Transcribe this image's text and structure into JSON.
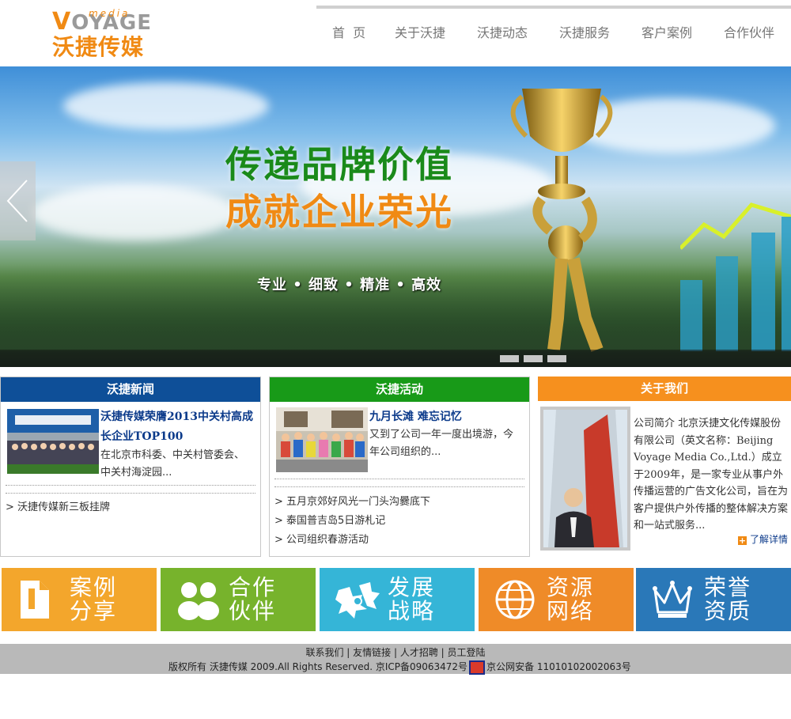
{
  "header": {
    "logo_en_v": "V",
    "logo_en_rest": "OYAGE",
    "logo_media": "media",
    "logo_cn": "沃捷传媒",
    "nav": [
      "首  页",
      "关于沃捷",
      "沃捷动态",
      "沃捷服务",
      "客户案例",
      "合作伙伴"
    ]
  },
  "banner": {
    "title1": "传递品牌价值",
    "title2": "成就企业荣光",
    "slogan": "专业 • 细致 • 精准 • 高效",
    "slide_count": 3
  },
  "news": {
    "heading": "沃捷新闻",
    "featured_title": "沃捷传媒荣膺2013中关村高成长企业TOP100",
    "featured_title_line1": "沃捷传媒荣膺2013中关村高成",
    "featured_title_line2": "长企业TOP100",
    "featured_text_line1": "在北京市科委、中关村管委会、",
    "featured_text_line2": "中关村海淀园...",
    "list": [
      "> 沃捷传媒新三板挂牌"
    ]
  },
  "activity": {
    "heading": "沃捷活动",
    "featured_title": "九月长滩  难忘记忆",
    "featured_text_line1": "又到了公司一年一度出境游，今",
    "featured_text_line2": "年公司组织的...",
    "list": [
      "> 五月京郊好风光一门头沟爨底下",
      "> 泰国普吉岛5日游札记",
      "> 公司组织春游活动"
    ]
  },
  "about": {
    "heading": "关于我们",
    "text": "公司简介 北京沃捷文化传媒股份有限公司（英文名称：Beijing Voyage Media Co.,Ltd.）成立于2009年，是一家专业从事户外传播运营的广告文化公司，旨在为客户提供户外传播的整体解决方案和一站式服务...",
    "more": "了解详情"
  },
  "tiles": [
    {
      "line1": "案例",
      "line2": "分享",
      "icon": "document-icon",
      "color": "#f3a62c"
    },
    {
      "line1": "合作",
      "line2": "伙伴",
      "icon": "partners-icon",
      "color": "#77b32c"
    },
    {
      "line1": "发展",
      "line2": "战略",
      "icon": "holly-icon",
      "color": "#35b5d7"
    },
    {
      "line1": "资源",
      "line2": "网络",
      "icon": "globe-icon",
      "color": "#ef8b28"
    },
    {
      "line1": "荣誉",
      "line2": "资质",
      "icon": "crown-icon",
      "color": "#2a78b8"
    }
  ],
  "footer": {
    "links": [
      "联系我们",
      "友情链接",
      "人才招聘",
      "员工登陆"
    ],
    "copyright": "版权所有  沃捷传媒  2009.All Rights Reserved. 京ICP备09063472号",
    "police": "京公网安备  11010102002063号"
  }
}
